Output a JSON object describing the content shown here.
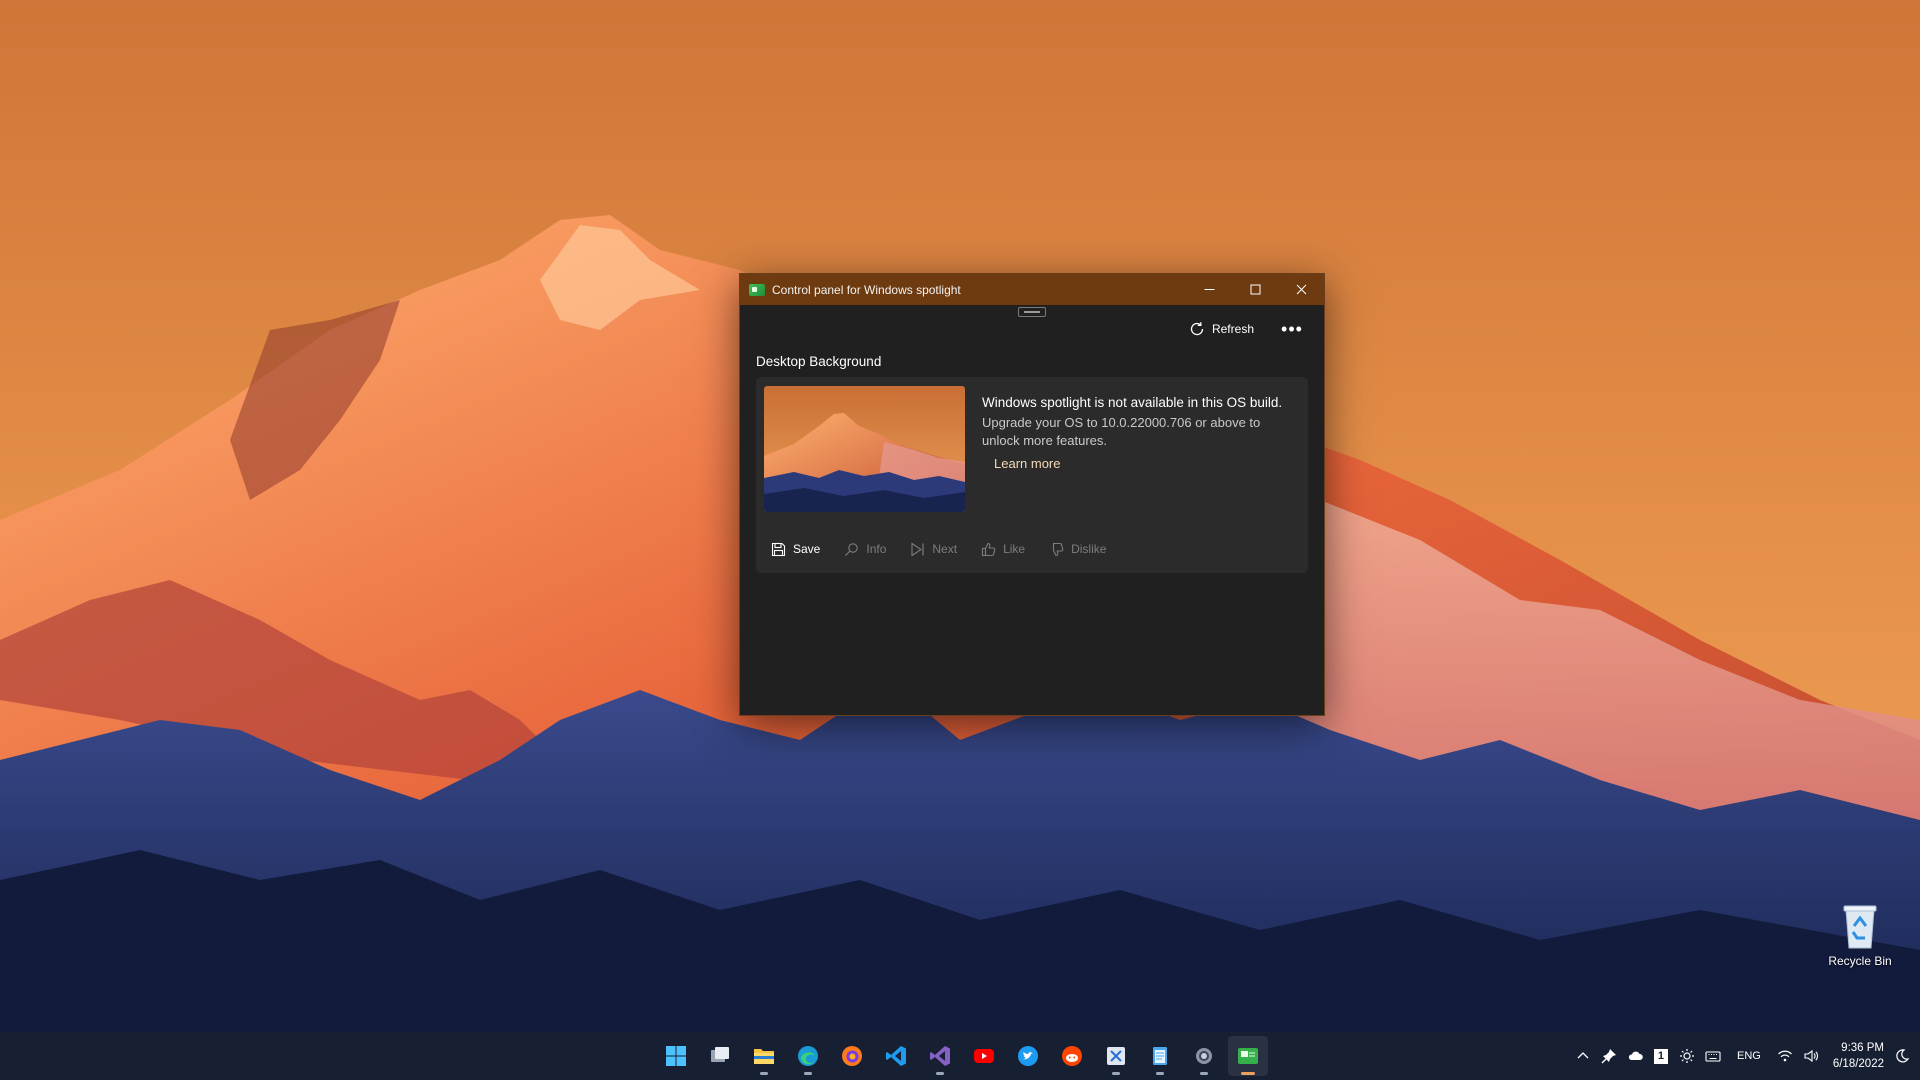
{
  "desktop": {
    "icons": [
      {
        "label": "Recycle Bin",
        "icon": "recycle-bin-icon"
      }
    ]
  },
  "window": {
    "title": "Control panel for Windows spotlight",
    "title_bar_color": "#6e3a0f",
    "toolbar": {
      "refresh_label": "Refresh",
      "more_label": "•••"
    },
    "section_title": "Desktop Background",
    "card": {
      "message_title": "Windows spotlight is not available in this OS build.",
      "message_body": "Upgrade your OS to 10.0.22000.706 or above to unlock more features.",
      "learn_more": "Learn more",
      "actions": [
        {
          "label": "Save",
          "icon": "save-icon",
          "enabled": true
        },
        {
          "label": "Info",
          "icon": "search-icon",
          "enabled": false
        },
        {
          "label": "Next",
          "icon": "next-icon",
          "enabled": false
        },
        {
          "label": "Like",
          "icon": "thumbs-up-icon",
          "enabled": false
        },
        {
          "label": "Dislike",
          "icon": "thumbs-down-icon",
          "enabled": false
        }
      ]
    }
  },
  "taskbar": {
    "apps": [
      {
        "name": "start",
        "icon": "windows-logo-icon"
      },
      {
        "name": "task-view",
        "icon": "task-view-icon"
      },
      {
        "name": "file-explorer",
        "icon": "folder-icon"
      },
      {
        "name": "edge",
        "icon": "edge-icon"
      },
      {
        "name": "firefox",
        "icon": "firefox-icon"
      },
      {
        "name": "vscode",
        "icon": "vscode-icon"
      },
      {
        "name": "visual-studio",
        "icon": "visual-studio-icon"
      },
      {
        "name": "youtube",
        "icon": "youtube-icon"
      },
      {
        "name": "twitter",
        "icon": "twitter-icon"
      },
      {
        "name": "reddit",
        "icon": "reddit-icon"
      },
      {
        "name": "snipping",
        "icon": "snipping-icon"
      },
      {
        "name": "notepad",
        "icon": "notepad-icon"
      },
      {
        "name": "settings",
        "icon": "settings-gear-icon"
      },
      {
        "name": "spotlight-control-panel",
        "icon": "spotlight-app-icon"
      }
    ],
    "tray": {
      "language": "ENG",
      "time": "9:36 PM",
      "date": "6/18/2022",
      "badge_number": "1"
    }
  }
}
